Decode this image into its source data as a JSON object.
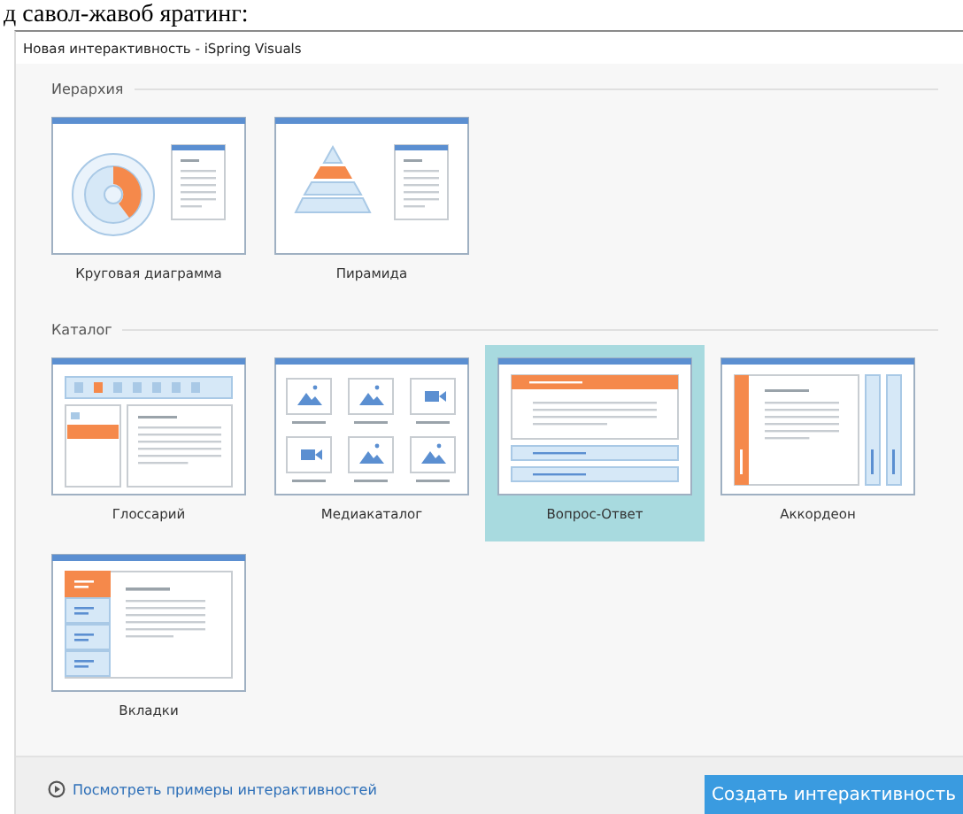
{
  "document_text": "д савол-жавоб яратинг:",
  "window": {
    "title": "Новая интерактивность - iSpring Visuals"
  },
  "sections": [
    {
      "title": "Иерархия",
      "items": [
        {
          "label": "Круговая диаграмма",
          "kind": "cycle",
          "selected": false
        },
        {
          "label": "Пирамида",
          "kind": "pyramid",
          "selected": false
        }
      ]
    },
    {
      "title": "Каталог",
      "items": [
        {
          "label": "Глоссарий",
          "kind": "glossary",
          "selected": false
        },
        {
          "label": "Медиакаталог",
          "kind": "media",
          "selected": false
        },
        {
          "label": "Вопрос-Ответ",
          "kind": "faq",
          "selected": true
        },
        {
          "label": "Аккордеон",
          "kind": "accordion",
          "selected": false
        },
        {
          "label": "Вкладки",
          "kind": "tabs",
          "selected": false
        }
      ]
    }
  ],
  "footer": {
    "link": "Посмотреть примеры интерактивностей",
    "button": "Создать интерактивность"
  }
}
